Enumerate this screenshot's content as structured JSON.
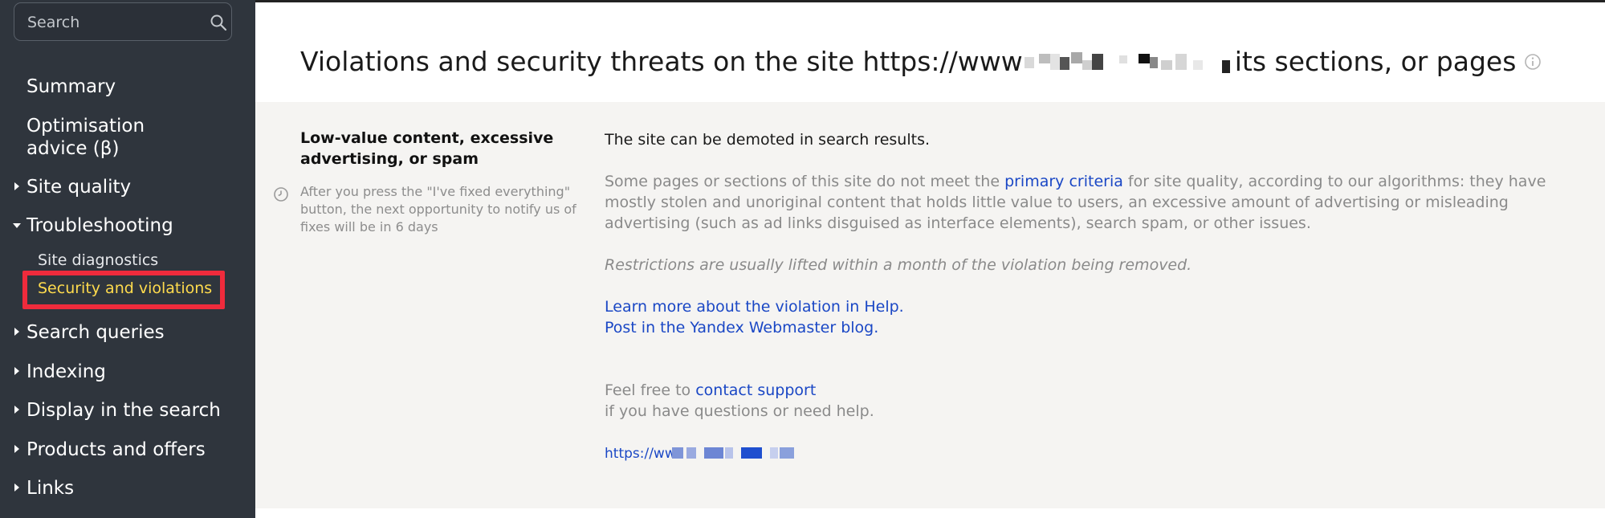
{
  "search": {
    "placeholder": "Search"
  },
  "sidebar": {
    "summary": "Summary",
    "optimisation": "Optimisation\nadvice (β)",
    "site_quality": "Site quality",
    "troubleshooting": "Troubleshooting",
    "site_diagnostics": "Site diagnostics",
    "security_violations": "Security and violations",
    "search_queries": "Search queries",
    "indexing": "Indexing",
    "display_in_search": "Display in the search",
    "products_offers": "Products and offers",
    "links": "Links"
  },
  "header": {
    "title_prefix": "Violations and security threats on the site https://www",
    "title_suffix": "its sections, or pages"
  },
  "violation": {
    "title": "Low-value content, excessive advertising, or spam",
    "note": "After you press the \"I've fixed everything\" button, the next opportunity to notify us of fixes will be in 6 days",
    "status": "The site can be demoted in search results.",
    "desc_before": "Some pages or sections of this site do not meet the ",
    "desc_link": "primary criteria",
    "desc_after": " for site quality, according to our algorithms: they have mostly stolen and unoriginal content that holds little value to users, an excessive amount of advertising or misleading advertising (such as ad links disguised as interface elements), search spam, or other issues.",
    "restrictions": "Restrictions are usually lifted within a month of the violation being removed.",
    "help_link": "Learn more about the violation in Help.",
    "blog_link": "Post in the Yandex Webmaster blog.",
    "support_prefix": "Feel free to ",
    "support_link": "contact support",
    "support_suffix": "if you have questions or need help.",
    "url_prefix": "https://ww"
  },
  "colors": {
    "sidebar_bg": "#2f353d",
    "active_item": "#ffdb4d",
    "highlight_border": "#ef2b3c",
    "link": "#1a47c5",
    "content_bg": "#f5f4f2"
  },
  "icons": [
    "search-icon",
    "info-icon",
    "clock-icon",
    "chevron-right-icon",
    "chevron-down-icon"
  ]
}
